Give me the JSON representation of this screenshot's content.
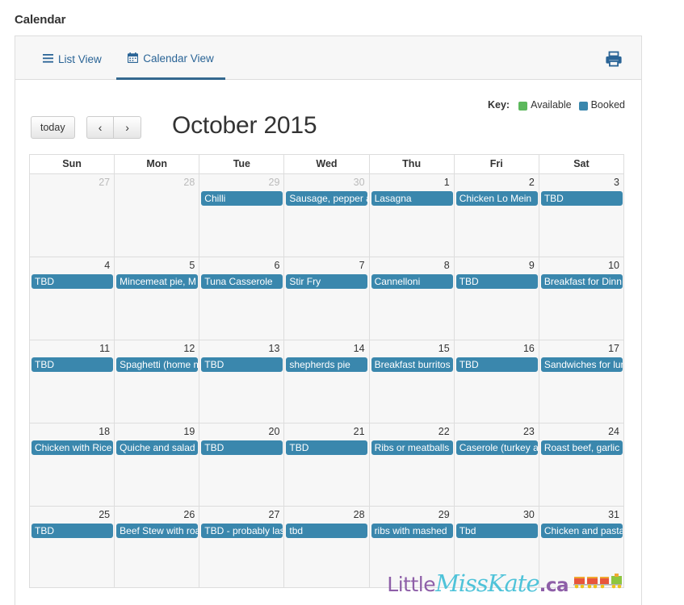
{
  "page": {
    "title": "Calendar",
    "background": "#ffffff"
  },
  "tabs": [
    {
      "id": "list-view",
      "label": "List View",
      "icon": "list-icon",
      "active": false
    },
    {
      "id": "calendar-view",
      "label": "Calendar View",
      "icon": "calendar-icon",
      "active": true
    }
  ],
  "toolbar": {
    "print_icon": "printer-icon",
    "today_label": "today",
    "prev_label": "‹",
    "next_label": "›",
    "calendar_title": "October 2015"
  },
  "key": {
    "label": "Key:",
    "items": [
      {
        "label": "Available",
        "color": "#5cb85c"
      },
      {
        "label": "Booked",
        "color": "#3a87ad"
      }
    ]
  },
  "calendar": {
    "day_headers": [
      "Sun",
      "Mon",
      "Tue",
      "Wed",
      "Thu",
      "Fri",
      "Sat"
    ],
    "event_color": "#3a87ad",
    "weeks": [
      [
        {
          "day": "27",
          "other_month": true,
          "event": null
        },
        {
          "day": "28",
          "other_month": true,
          "event": null
        },
        {
          "day": "29",
          "other_month": true,
          "event": "Chilli"
        },
        {
          "day": "30",
          "other_month": true,
          "event": "Sausage, pepper and"
        },
        {
          "day": "1",
          "other_month": false,
          "event": "Lasagna"
        },
        {
          "day": "2",
          "other_month": false,
          "event": "Chicken Lo Mein"
        },
        {
          "day": "3",
          "other_month": false,
          "event": "TBD"
        }
      ],
      [
        {
          "day": "4",
          "other_month": false,
          "event": "TBD"
        },
        {
          "day": "5",
          "other_month": false,
          "event": "Mincemeat pie, M"
        },
        {
          "day": "6",
          "other_month": false,
          "event": "Tuna Casserole"
        },
        {
          "day": "7",
          "other_month": false,
          "event": "Stir Fry"
        },
        {
          "day": "8",
          "other_month": false,
          "event": "Cannelloni"
        },
        {
          "day": "9",
          "other_month": false,
          "event": "TBD"
        },
        {
          "day": "10",
          "other_month": false,
          "event": "Breakfast for Dinn"
        }
      ],
      [
        {
          "day": "11",
          "other_month": false,
          "event": "TBD"
        },
        {
          "day": "12",
          "other_month": false,
          "event": "Spaghetti (home m"
        },
        {
          "day": "13",
          "other_month": false,
          "event": "TBD"
        },
        {
          "day": "14",
          "other_month": false,
          "event": "shepherds pie"
        },
        {
          "day": "15",
          "other_month": false,
          "event": "Breakfast burritos"
        },
        {
          "day": "16",
          "other_month": false,
          "event": "TBD"
        },
        {
          "day": "17",
          "other_month": false,
          "event": "Sandwiches for lun"
        }
      ],
      [
        {
          "day": "18",
          "other_month": false,
          "event": "Chicken with Rice"
        },
        {
          "day": "19",
          "other_month": false,
          "event": "Quiche and salad"
        },
        {
          "day": "20",
          "other_month": false,
          "event": "TBD"
        },
        {
          "day": "21",
          "other_month": false,
          "event": "TBD"
        },
        {
          "day": "22",
          "other_month": false,
          "event": "Ribs or meatballs"
        },
        {
          "day": "23",
          "other_month": false,
          "event": "Caserole (turkey a"
        },
        {
          "day": "24",
          "other_month": false,
          "event": "Roast beef, garlic"
        }
      ],
      [
        {
          "day": "25",
          "other_month": false,
          "event": "TBD"
        },
        {
          "day": "26",
          "other_month": false,
          "event": "Beef Stew with roa"
        },
        {
          "day": "27",
          "other_month": false,
          "event": "TBD - probably las"
        },
        {
          "day": "28",
          "other_month": false,
          "event": "tbd"
        },
        {
          "day": "29",
          "other_month": false,
          "event": "ribs with mashed"
        },
        {
          "day": "30",
          "other_month": false,
          "event": "Tbd"
        },
        {
          "day": "31",
          "other_month": false,
          "event": "Chicken and pasta"
        }
      ]
    ]
  },
  "logo": {
    "part1": "Little",
    "part2": "MissKate",
    "part3": ".ca",
    "colors": {
      "purple": "#8e5fa8",
      "teal": "#4fc3d9"
    }
  }
}
